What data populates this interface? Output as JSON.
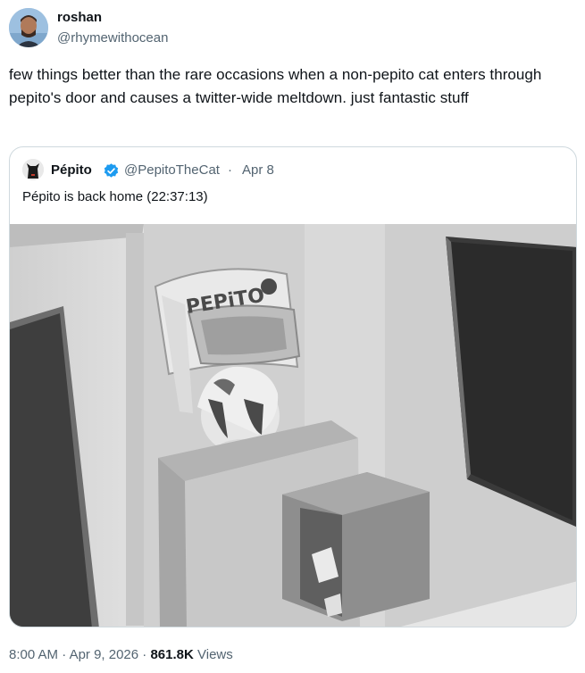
{
  "tweet": {
    "author": {
      "name": "roshan",
      "handle": "@rhymewithocean"
    },
    "text": "few things better than the rare occasions when a non-pepito cat enters through pepito's door and causes a twitter-wide meltdown. just fantastic stuff",
    "meta": {
      "time": "8:00 AM",
      "separator1": " · ",
      "date": "Apr 9, 2026",
      "separator2": " · ",
      "views_count": "861.8K",
      "views_label": " Views"
    }
  },
  "quoted_tweet": {
    "author": {
      "name": "Pépito",
      "handle": "@PepitoTheCat",
      "verified": true
    },
    "separator": "·",
    "date": "Apr 8",
    "text": "Pépito is back home (22:37:13)",
    "media": {
      "door_sign": "PEPiTO",
      "colors": {
        "verified_badge": "#1d9bf0"
      }
    }
  }
}
